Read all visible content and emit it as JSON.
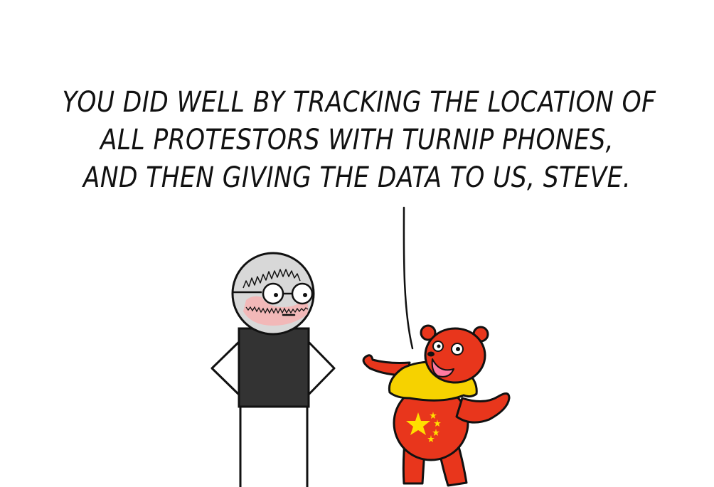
{
  "speech": {
    "lines": [
      "YOU DID WELL BY TRACKING THE LOCATION OF",
      "ALL PROTESTORS WITH TURNIP PHONES,",
      "AND THEN GIVING THE DATA TO US, STEVE."
    ]
  },
  "colors": {
    "background": "#ffffff",
    "ink": "#111111",
    "shirt_dark": "#333333",
    "face_gray": "#d8d8d8",
    "blush_pink": "#f2b8b8",
    "bear_red": "#e8361c",
    "bear_shirt_yellow": "#f6d200",
    "star_yellow": "#ffde00",
    "tongue": "#ff7aa0"
  }
}
